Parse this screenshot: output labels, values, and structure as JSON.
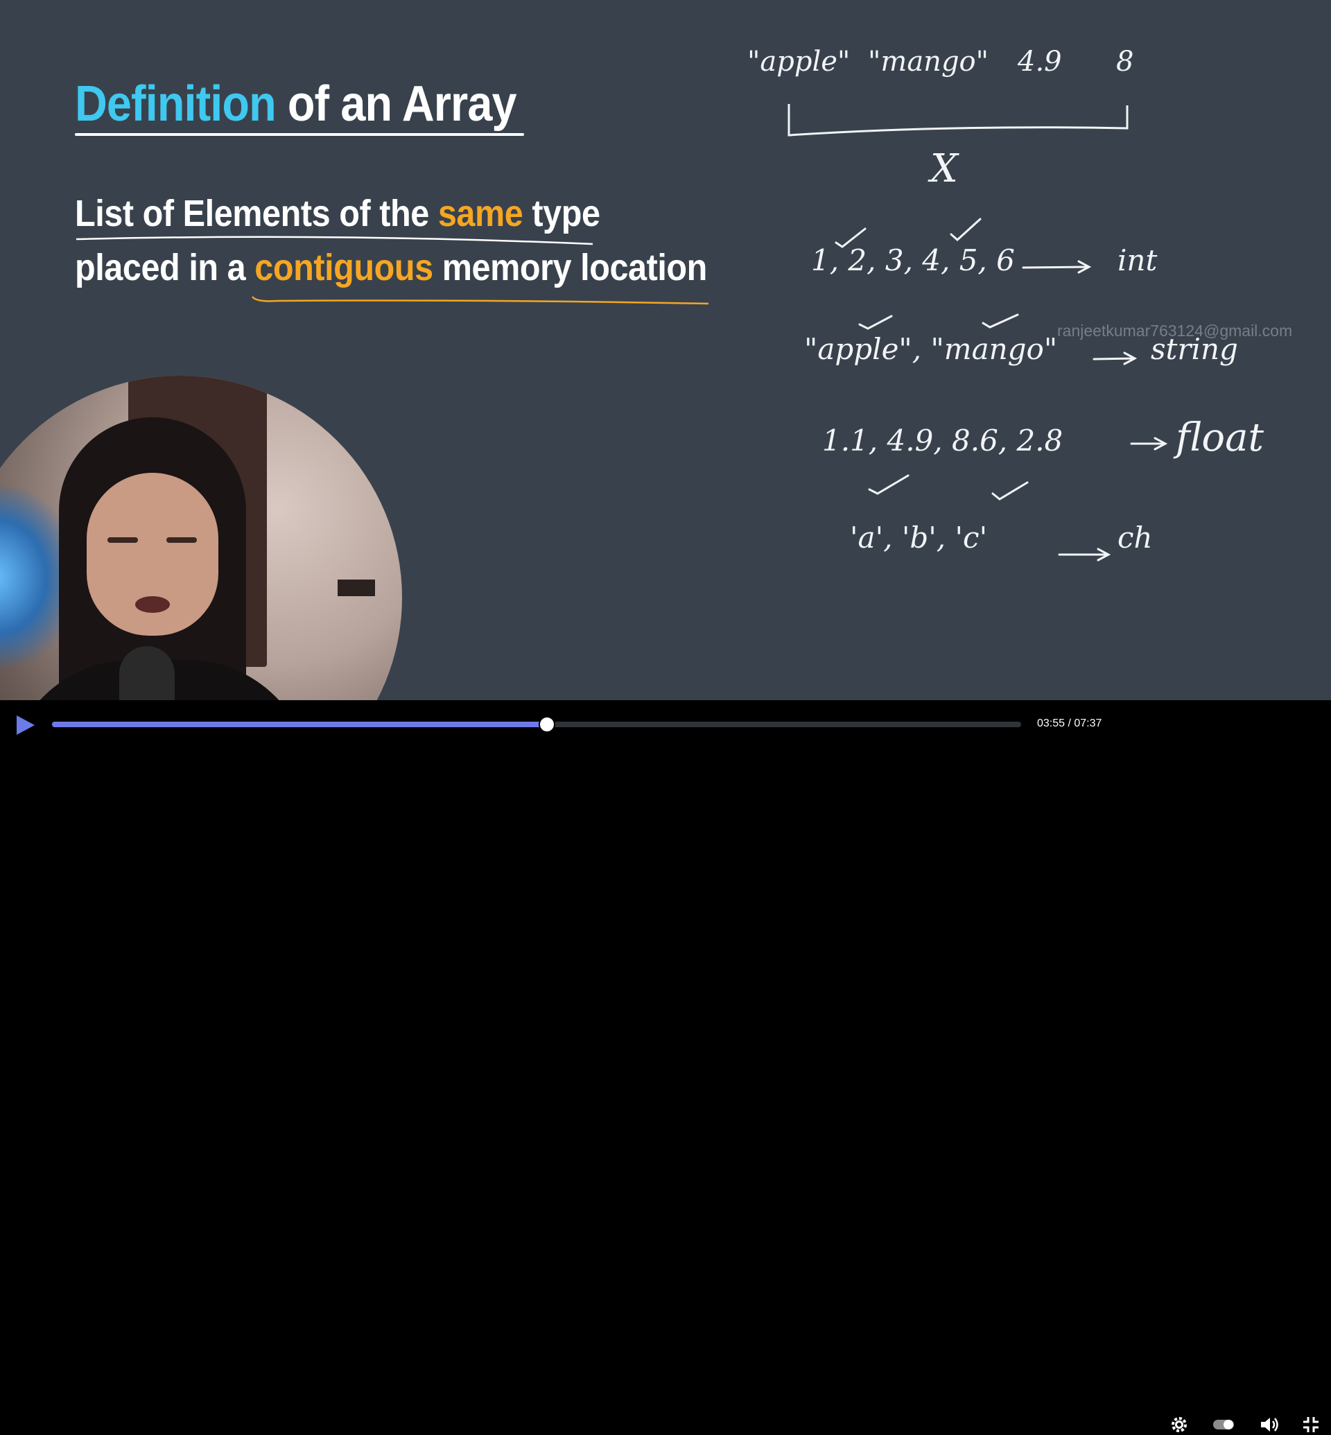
{
  "slide": {
    "title_accent": "Definition",
    "title_rest": " of an Array",
    "line1_before": "List of Elements of the ",
    "line1_accent": "same",
    "line1_after": " type",
    "line2_before": "placed in a ",
    "line2_accent": "contiguous",
    "line2_after": " memory location"
  },
  "watermark": "ranjeetkumar763124@gmail.com",
  "whiteboard": {
    "top_items": [
      "\"apple\"",
      "\"mango\"",
      "4.9",
      "8"
    ],
    "cross": "X",
    "rows": [
      {
        "values": "1, 2, 3, 4, 5, 6",
        "type": "int"
      },
      {
        "values": "\"apple\", \"mango\"",
        "type": "string"
      },
      {
        "values": "1.1, 4.9, 8.6, 2.8",
        "type": "float"
      },
      {
        "values": "'a', 'b', 'c'",
        "type": "ch"
      }
    ]
  },
  "player": {
    "time": "03:55 / 07:37",
    "progress": 0.5106,
    "icons": [
      "play-icon",
      "settings-gear-icon",
      "toggle-icon",
      "volume-icon",
      "exit-fullscreen-icon"
    ]
  },
  "colors": {
    "background": "#39424c",
    "title_accent": "#3fc8f0",
    "text_accent": "#f5a623",
    "progress": "#6d7be8"
  }
}
